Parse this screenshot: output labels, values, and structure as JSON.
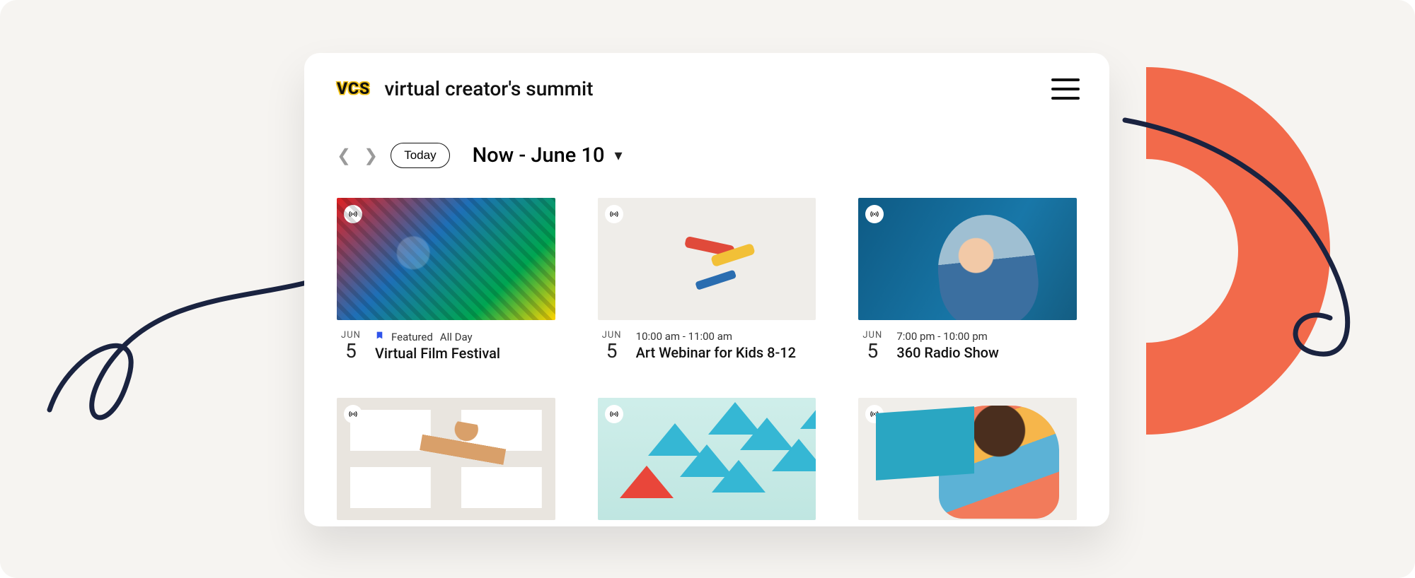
{
  "header": {
    "logo_text": "VCS",
    "site_title": "virtual creator's summit"
  },
  "toolbar": {
    "today_label": "Today",
    "date_range": "Now - June 10"
  },
  "events": [
    {
      "month": "JUN",
      "day": "5",
      "featured_label": "Featured",
      "time": "All Day",
      "title": "Virtual Film Festival",
      "featured": true
    },
    {
      "month": "JUN",
      "day": "5",
      "time": "10:00 am - 11:00 am",
      "title": "Art Webinar for Kids 8-12",
      "featured": false
    },
    {
      "month": "JUN",
      "day": "5",
      "time": "7:00 pm - 10:00 pm",
      "title": "360 Radio Show",
      "featured": false
    }
  ]
}
